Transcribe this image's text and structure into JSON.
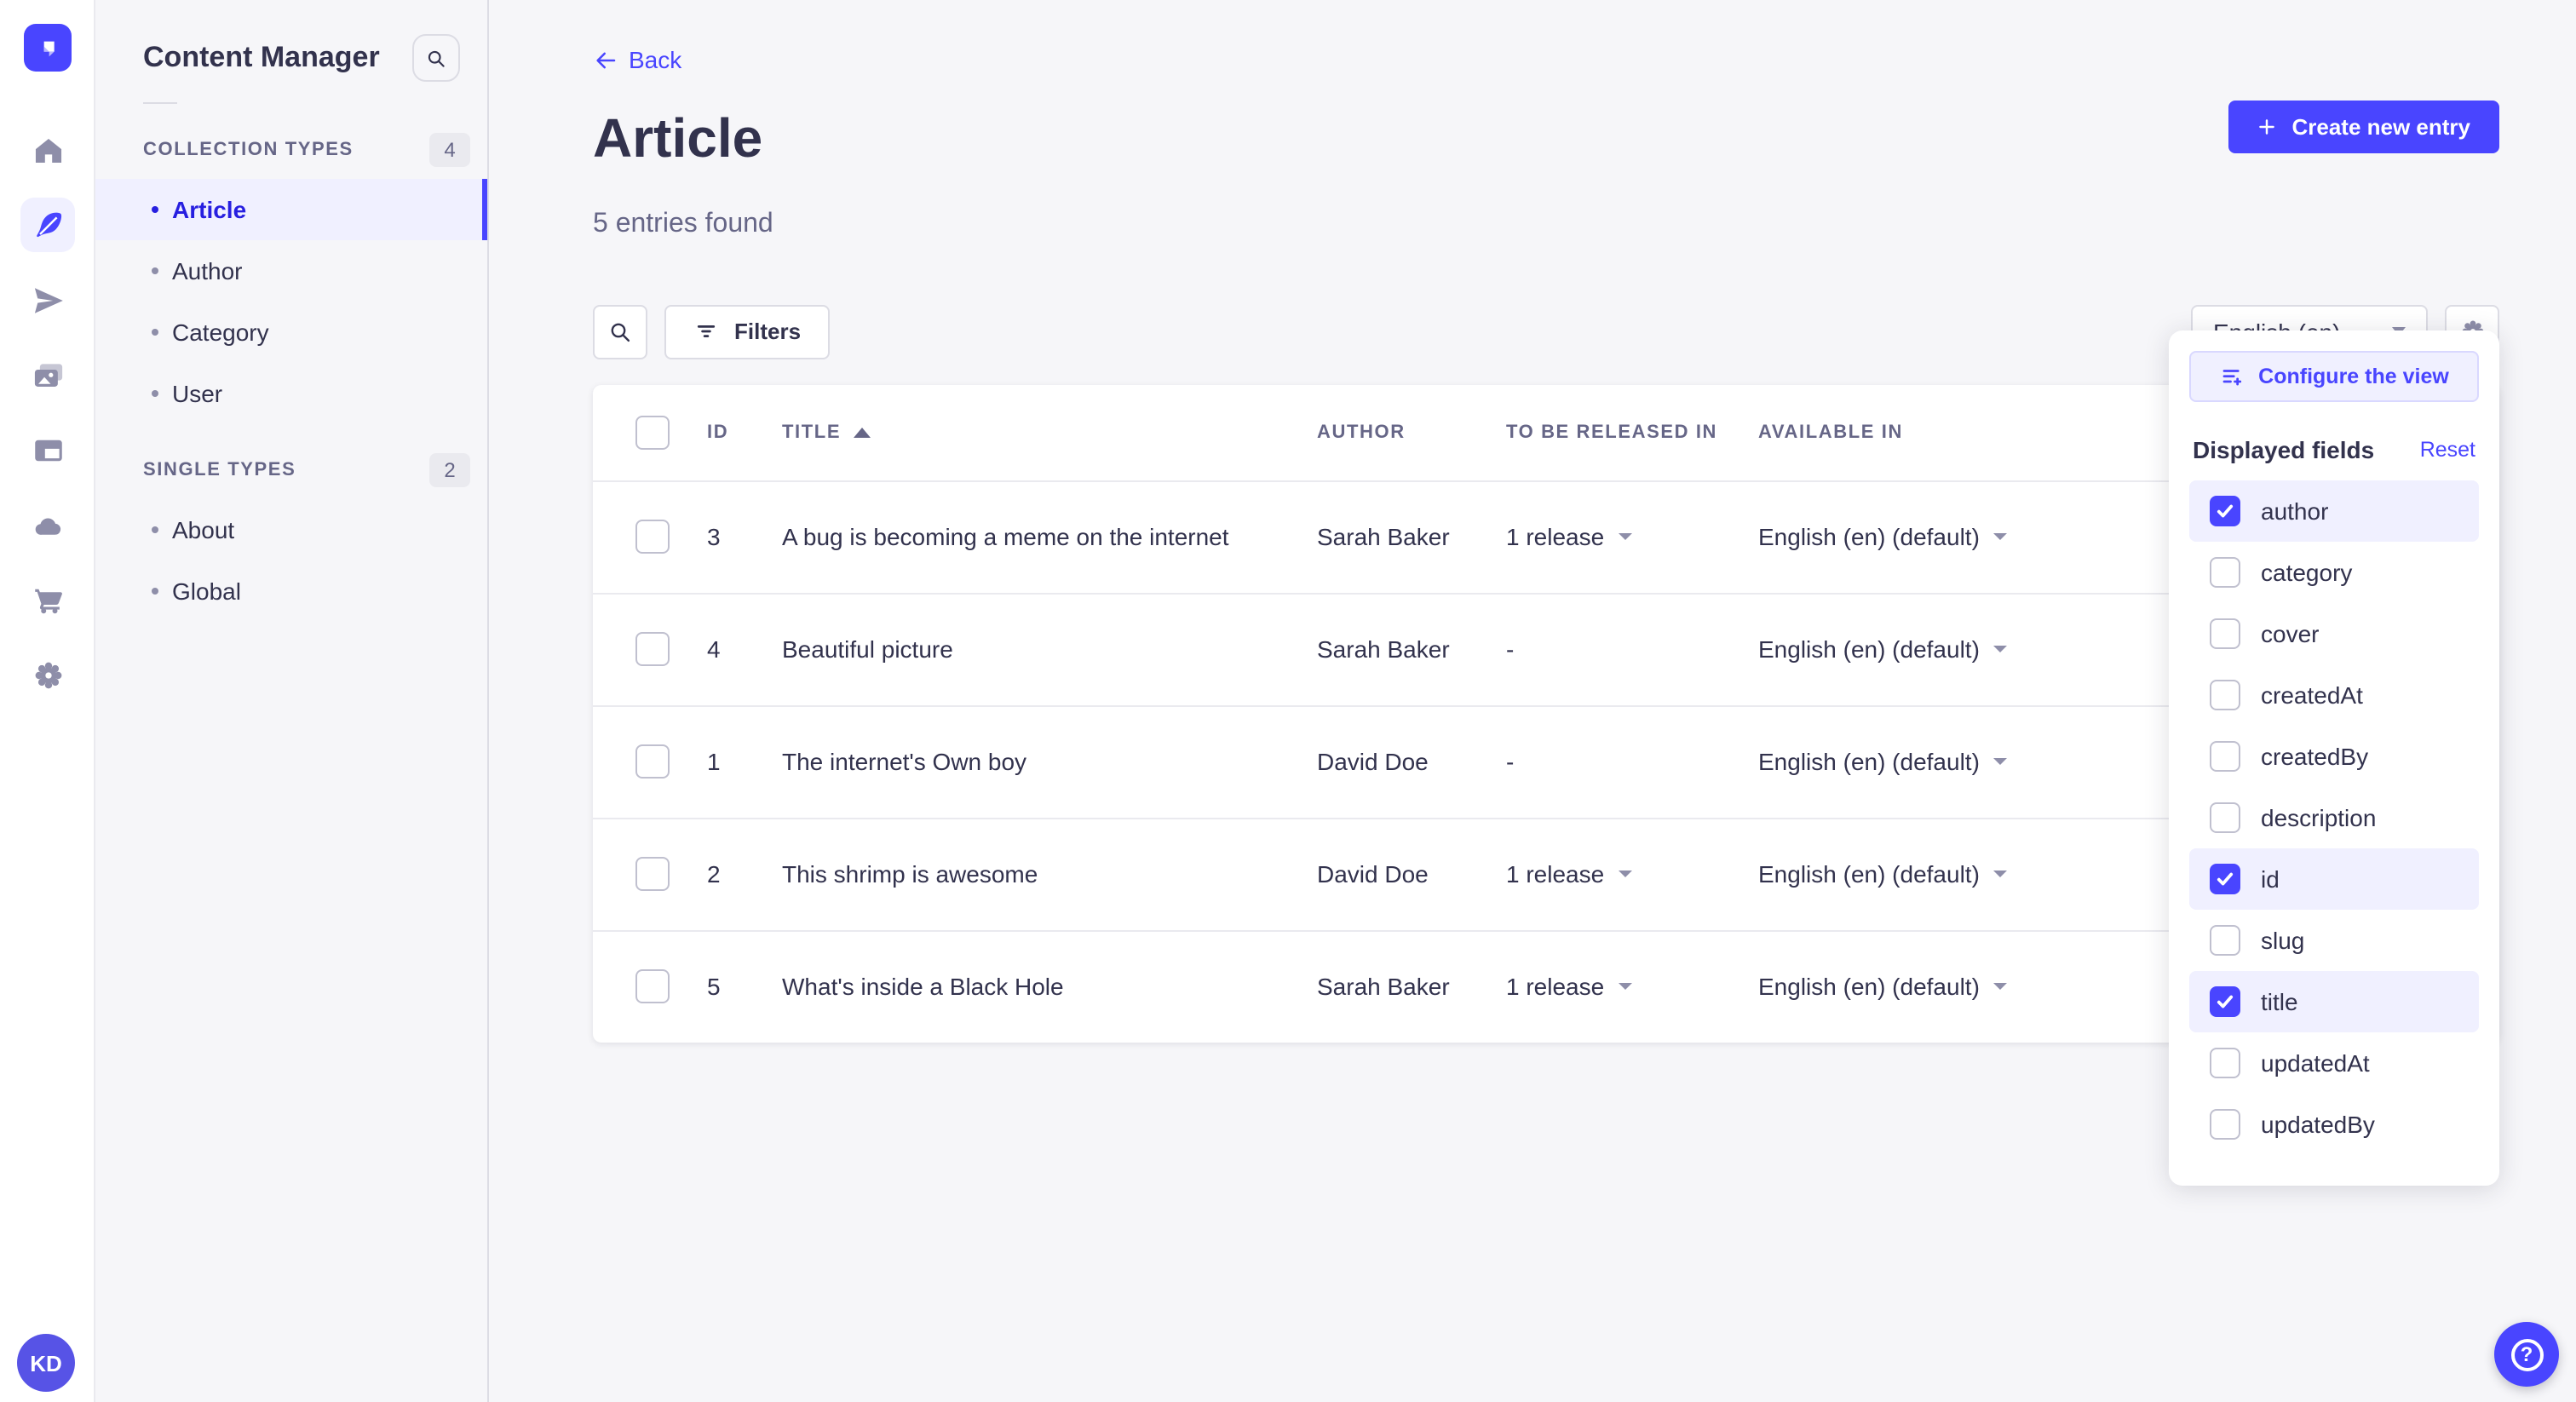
{
  "colors": {
    "primary": "#4945ff",
    "primary_dark": "#271fe0",
    "primary_bg": "#f0f0ff",
    "primary_border": "#d9d8ff",
    "text_dark": "#32324d",
    "text_gray": "#666687",
    "text_light": "#8e8ea9",
    "border": "#eaeaef",
    "input_border": "#dcdce4",
    "canvas_bg": "#f6f6f9",
    "card_bg": "#ffffff"
  },
  "rail": {
    "items": [
      {
        "icon": "home-icon",
        "active": false
      },
      {
        "icon": "content-manager-feather-icon",
        "active": true
      },
      {
        "icon": "paper-plane-icon",
        "active": false
      },
      {
        "icon": "media-library-icon",
        "active": false
      },
      {
        "icon": "layout-panel-icon",
        "active": false
      },
      {
        "icon": "cloud-icon",
        "active": false
      },
      {
        "icon": "cart-icon",
        "active": false
      },
      {
        "icon": "gear-icon",
        "active": false
      }
    ],
    "avatar_initials": "KD"
  },
  "sidebar": {
    "title": "Content Manager",
    "sections": [
      {
        "label": "COLLECTION TYPES",
        "badge": "4",
        "items": [
          {
            "label": "Article",
            "active": true
          },
          {
            "label": "Author",
            "active": false
          },
          {
            "label": "Category",
            "active": false
          },
          {
            "label": "User",
            "active": false
          }
        ]
      },
      {
        "label": "SINGLE TYPES",
        "badge": "2",
        "items": [
          {
            "label": "About",
            "active": false
          },
          {
            "label": "Global",
            "active": false
          }
        ]
      }
    ]
  },
  "header": {
    "back_label": "Back",
    "title": "Article",
    "subtitle": "5 entries found",
    "create_label": "Create new entry"
  },
  "toolbar": {
    "search_icon": "search-icon",
    "filters_label": "Filters",
    "locale_value": "English (en)",
    "settings_icon": "gear-icon"
  },
  "table": {
    "columns": [
      "ID",
      "TITLE",
      "AUTHOR",
      "TO BE RELEASED IN",
      "AVAILABLE IN"
    ],
    "sorted_column": "TITLE",
    "sort_direction": "asc",
    "rows": [
      {
        "id": "3",
        "title": "A bug is becoming a meme on the internet",
        "author": "Sarah Baker",
        "release": "1 release",
        "release_caret": true,
        "available": "English (en) (default)"
      },
      {
        "id": "4",
        "title": "Beautiful picture",
        "author": "Sarah Baker",
        "release": "-",
        "release_caret": false,
        "available": "English (en) (default)"
      },
      {
        "id": "1",
        "title": "The internet's Own boy",
        "author": "David Doe",
        "release": "-",
        "release_caret": false,
        "available": "English (en) (default)"
      },
      {
        "id": "2",
        "title": "This shrimp is awesome",
        "author": "David Doe",
        "release": "1 release",
        "release_caret": true,
        "available": "English (en) (default)"
      },
      {
        "id": "5",
        "title": "What's inside a Black Hole",
        "author": "Sarah Baker",
        "release": "1 release",
        "release_caret": true,
        "available": "English (en) (default)"
      }
    ]
  },
  "popover": {
    "configure_label": "Configure the view",
    "fields_title": "Displayed fields",
    "reset_label": "Reset",
    "fields": [
      {
        "label": "author",
        "checked": true
      },
      {
        "label": "category",
        "checked": false
      },
      {
        "label": "cover",
        "checked": false
      },
      {
        "label": "createdAt",
        "checked": false
      },
      {
        "label": "createdBy",
        "checked": false
      },
      {
        "label": "description",
        "checked": false
      },
      {
        "label": "id",
        "checked": true
      },
      {
        "label": "slug",
        "checked": false
      },
      {
        "label": "title",
        "checked": true
      },
      {
        "label": "updatedAt",
        "checked": false
      },
      {
        "label": "updatedBy",
        "checked": false
      }
    ]
  },
  "help": {
    "icon_char": "?"
  }
}
